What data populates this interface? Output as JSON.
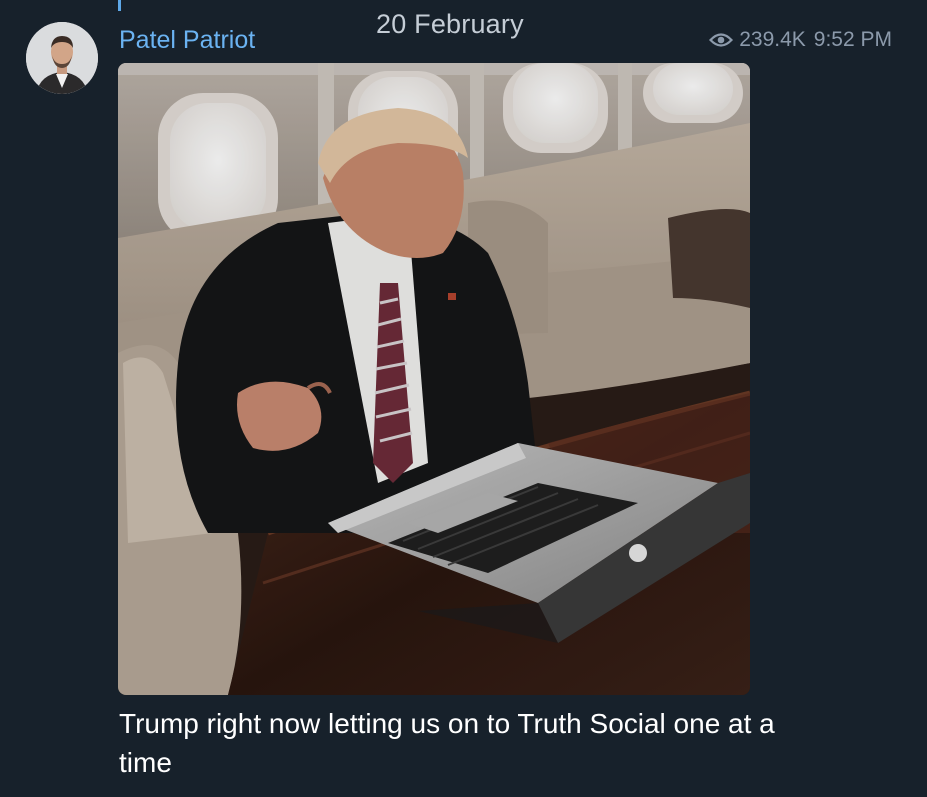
{
  "message": {
    "date_separator": "20 February",
    "sender_name": "Patel Patriot",
    "views": "239.4K",
    "time": "9:52 PM",
    "caption": "Trump right now letting us on to Truth Social one at a time"
  },
  "icons": {
    "views": "eye-icon"
  },
  "colors": {
    "background": "#17212b",
    "sender_name": "#6bb3f2",
    "meta_text": "#8c9aab",
    "caption_text": "#ffffff"
  }
}
